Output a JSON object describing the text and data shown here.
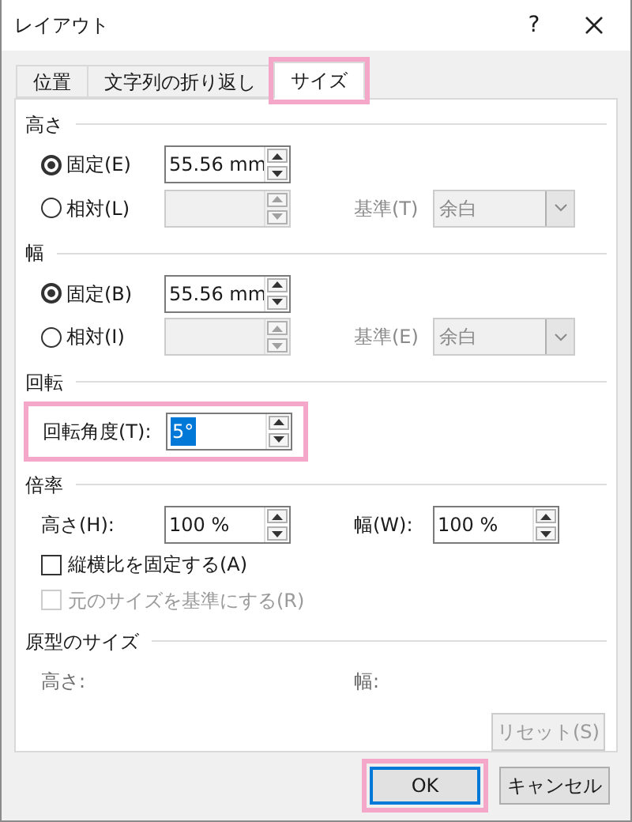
{
  "window": {
    "title": "レイアウト",
    "help": "?"
  },
  "tabs": [
    {
      "label": "位置",
      "selected": false,
      "highlighted": false
    },
    {
      "label": "文字列の折り返し",
      "selected": false,
      "highlighted": false
    },
    {
      "label": "サイズ",
      "selected": true,
      "highlighted": true
    }
  ],
  "sections": [
    {
      "title": "高さ",
      "rows": [
        {
          "kind": "radio",
          "label": "固定(E)",
          "selected": true,
          "field": {
            "value": "55.56 mm",
            "disabled": false
          }
        },
        {
          "kind": "radio",
          "label": "相対(L)",
          "selected": false,
          "field": {
            "disabled": true
          },
          "reference": {
            "label": "基準(T)",
            "value": "余白",
            "disabled": true
          }
        }
      ]
    },
    {
      "title": "幅",
      "rows": [
        {
          "kind": "radio",
          "label": "固定(B)",
          "selected": true,
          "field": {
            "value": "55.56 mm",
            "disabled": false
          }
        },
        {
          "kind": "radio",
          "label": "相対(I)",
          "selected": false,
          "field": {
            "disabled": true
          },
          "reference": {
            "label": "基準(E)",
            "value": "余白",
            "disabled": true
          }
        }
      ]
    },
    {
      "title": "回転",
      "rows": [
        {
          "kind": "spin",
          "label": "回転角度(T):",
          "highlighted": true,
          "field": {
            "value": "5°",
            "disabled": false,
            "text_selected": true
          }
        }
      ]
    },
    {
      "title": "倍率",
      "rows": [
        {
          "kind": "pair",
          "items": [
            {
              "label": "高さ(H):",
              "field": {
                "value": "100 %",
                "disabled": false
              }
            },
            {
              "label": "幅(W):",
              "field": {
                "value": "100 %",
                "disabled": false
              }
            }
          ]
        },
        {
          "kind": "checkbox",
          "label": "縦横比を固定する(A)",
          "checked": false,
          "disabled": false
        },
        {
          "kind": "checkbox",
          "label": "元のサイズを基準にする(R)",
          "checked": false,
          "disabled": true
        }
      ]
    },
    {
      "title": "原型のサイズ",
      "rows": [
        {
          "kind": "info",
          "items": [
            "高さ:",
            "幅:"
          ]
        },
        {
          "kind": "button",
          "label": "リセット(S)",
          "disabled": true
        }
      ]
    }
  ],
  "buttons": [
    {
      "label": "OK",
      "default": true,
      "highlighted": true
    },
    {
      "label": "キャンセル",
      "default": false,
      "highlighted": false
    }
  ]
}
